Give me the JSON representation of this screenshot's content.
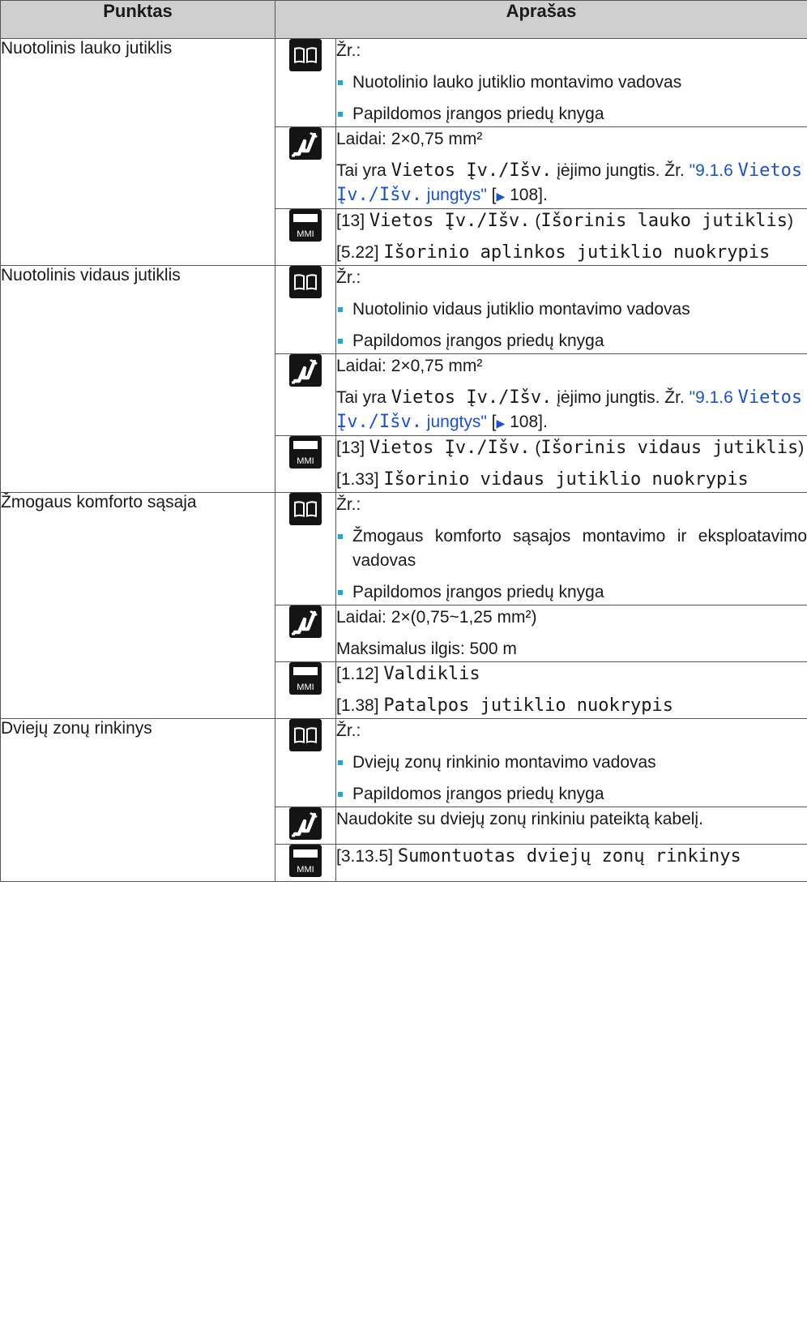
{
  "header": {
    "col_item": "Punktas",
    "col_desc": "Aprašas"
  },
  "icons": {
    "manual": "book-icon",
    "wiring": "cable-icon",
    "settings": "mmi-icon",
    "mmi_label": "MMI"
  },
  "rows": [
    {
      "item": "Nuotolinis lauko jutiklis",
      "manual": {
        "see": "Žr.:",
        "bullets": [
          "Nuotolinio lauko jutiklio montavimo vadovas",
          "Papildomos įrangos priedų knyga"
        ]
      },
      "wiring": {
        "line1": "Laidai: 2×0,75 mm²",
        "pre": "Tai yra ",
        "code": "Vietos Įv./Išv.",
        "mid": " įėjimo jungtis. Žr. ",
        "link_num": "\"9.1.6 ",
        "link_code": "Vietos Įv./Išv.",
        "link_tail": " jungtys\"",
        "ref_open": " [",
        "ref_page": " 108]."
      },
      "settings": [
        {
          "num": "[13] ",
          "code": "Vietos Įv./Išv.",
          "suffix_open": " (",
          "sub": "Išorinis lauko jutiklis",
          "suffix_close": ")"
        },
        {
          "num": "[5.22] ",
          "code": "Išorinio aplinkos jutiklio nuokrypis"
        }
      ]
    },
    {
      "item": "Nuotolinis vidaus jutiklis",
      "manual": {
        "see": "Žr.:",
        "bullets": [
          "Nuotolinio vidaus jutiklio montavimo vadovas",
          "Papildomos įrangos priedų knyga"
        ]
      },
      "wiring": {
        "line1": "Laidai: 2×0,75 mm²",
        "pre": "Tai yra ",
        "code": "Vietos Įv./Išv.",
        "mid": " įėjimo jungtis. Žr. ",
        "link_num": "\"9.1.6 ",
        "link_code": "Vietos Įv./Išv.",
        "link_tail": " jungtys\"",
        "ref_open": " [",
        "ref_page": " 108]."
      },
      "settings": [
        {
          "num": "[13] ",
          "code": "Vietos Įv./Išv.",
          "suffix_open": " (",
          "sub": "Išorinis vidaus jutiklis",
          "suffix_close": ")"
        },
        {
          "num": "[1.33] ",
          "code": "Išorinio vidaus jutiklio nuokrypis"
        }
      ]
    },
    {
      "item": "Žmogaus komforto sąsaja",
      "manual": {
        "see": "Žr.:",
        "bullets": [
          "Žmogaus komforto sąsajos montavimo ir eksploatavimo vadovas",
          "Papildomos įrangos priedų knyga"
        ]
      },
      "wiring": {
        "line1": "Laidai: 2×(0,75~1,25 mm²)",
        "line2": "Maksimalus ilgis: 500 m"
      },
      "settings": [
        {
          "num": "[1.12] ",
          "code": "Valdiklis"
        },
        {
          "num": "[1.38] ",
          "code": "Patalpos jutiklio nuokrypis"
        }
      ]
    },
    {
      "item": "Dviejų zonų rinkinys",
      "manual": {
        "see": "Žr.:",
        "bullets": [
          "Dviejų zonų rinkinio montavimo vadovas",
          "Papildomos įrangos priedų knyga"
        ]
      },
      "wiring": {
        "line1": "Naudokite su dviejų zonų rinkiniu pateiktą kabelį."
      },
      "settings": [
        {
          "num": "[3.13.5] ",
          "code": "Sumontuotas dviejų zonų rinkinys"
        }
      ]
    }
  ]
}
